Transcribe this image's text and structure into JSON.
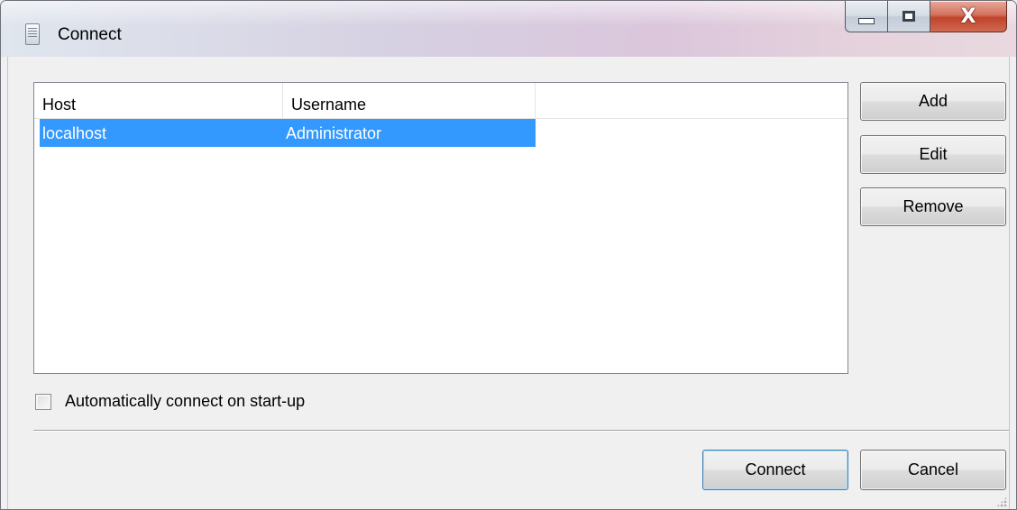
{
  "window": {
    "title": "Connect",
    "app_icon": "server-list-icon",
    "controls": {
      "minimize_icon": "minimize-icon",
      "maximize_icon": "maximize-icon",
      "close_glyph": "X"
    }
  },
  "listview": {
    "columns": [
      "Host",
      "Username",
      ""
    ],
    "rows": [
      {
        "host": "localhost",
        "username": "Administrator",
        "selected": true
      }
    ]
  },
  "side_buttons": {
    "add": "Add",
    "edit": "Edit",
    "remove": "Remove"
  },
  "auto_connect": {
    "label": "Automatically connect on start-up",
    "checked": false
  },
  "footer_buttons": {
    "connect": "Connect",
    "cancel": "Cancel"
  },
  "colors": {
    "selection": "#3399ff",
    "window_bg": "#f0f0f0",
    "close_button": "#c0432b"
  }
}
